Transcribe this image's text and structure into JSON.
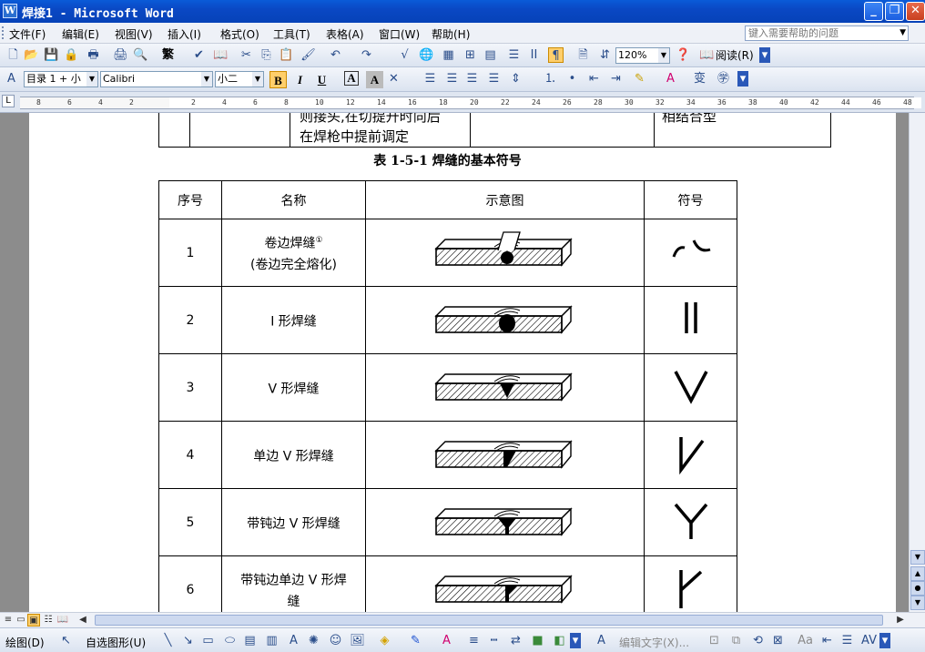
{
  "window": {
    "title": "焊接1 - Microsoft Word",
    "app_icon": "W",
    "minimize_glyph": "_",
    "maximize_glyph": "❐",
    "close_glyph": "✕"
  },
  "menu": {
    "items": [
      "文件(F)",
      "编辑(E)",
      "视图(V)",
      "插入(I)",
      "格式(O)",
      "工具(T)",
      "表格(A)",
      "窗口(W)",
      "帮助(H)"
    ],
    "help_placeholder": "键入需要帮助的问题"
  },
  "toolbar": {
    "zoom": "120%",
    "read_label": "阅读(R)",
    "trad_simp": "繁"
  },
  "format_bar": {
    "style": "目录 1 + 小",
    "font": "Calibri",
    "size": "小二",
    "bold": "B",
    "italic": "I",
    "underline": "U",
    "char_border": "A",
    "char_shading": "A"
  },
  "ruler": {
    "ticks": [
      "8",
      "6",
      "4",
      "2",
      "",
      "2",
      "4",
      "6",
      "8",
      "10",
      "12",
      "14",
      "16",
      "18",
      "20",
      "22",
      "24",
      "26",
      "28",
      "30",
      "32",
      "34",
      "36",
      "38",
      "40",
      "42",
      "44",
      "46",
      "48"
    ]
  },
  "document": {
    "prev_table_cells": [
      "",
      "",
      "则接头,在切提升时向后\n在焊枪中提前调定",
      "",
      "相结合型"
    ],
    "caption": "表 1-5-1 焊缝的基本符号",
    "columns": [
      "序号",
      "名称",
      "示意图",
      "符号"
    ],
    "rows": [
      {
        "no": "1",
        "name": "卷边焊缝",
        "footnote": "①",
        "name2": "(卷边完全熔化)",
        "symbol": "curl"
      },
      {
        "no": "2",
        "name": "I 形焊缝",
        "footnote": "",
        "name2": "",
        "symbol": "I"
      },
      {
        "no": "3",
        "name": "V 形焊缝",
        "footnote": "",
        "name2": "",
        "symbol": "V"
      },
      {
        "no": "4",
        "name": "单边 V 形焊缝",
        "footnote": "",
        "name2": "",
        "symbol": "halfV"
      },
      {
        "no": "5",
        "name": "带钝边 V 形焊缝",
        "footnote": "",
        "name2": "",
        "symbol": "Y"
      },
      {
        "no": "6",
        "name": "带钝边单边 V 形焊",
        "footnote": "",
        "name2": "缝",
        "symbol": "halfY"
      }
    ]
  },
  "drawbar": {
    "draw_label": "绘图(D)",
    "autoshape_label": "自选图形(U)",
    "edit_text_label": "编辑文字(X)..."
  }
}
